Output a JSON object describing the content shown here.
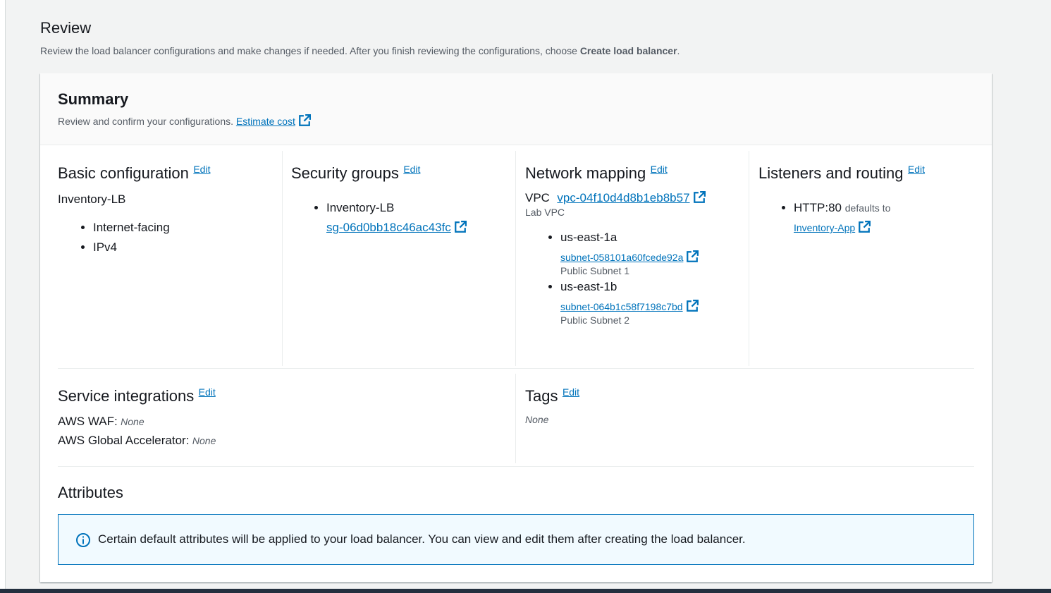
{
  "review": {
    "title": "Review",
    "description_prefix": "Review the load balancer configurations and make changes if needed. After you finish reviewing the configurations, choose ",
    "description_bold": "Create load balancer",
    "description_suffix": "."
  },
  "summary": {
    "title": "Summary",
    "description": "Review and confirm your configurations.",
    "estimate_cost_link": "Estimate cost"
  },
  "edit_label": "Edit",
  "basic_configuration": {
    "title": "Basic configuration",
    "name": "Inventory-LB",
    "items": [
      "Internet-facing",
      "IPv4"
    ]
  },
  "security_groups": {
    "title": "Security groups",
    "group_name": "Inventory-LB",
    "group_id": "sg-06d0bb18c46ac43fc"
  },
  "network_mapping": {
    "title": "Network mapping",
    "vpc_label": "VPC",
    "vpc_id": "vpc-04f10d4d8b1eb8b57",
    "vpc_name": "Lab VPC",
    "zones": [
      {
        "zone": "us-east-1a",
        "subnet_id": "subnet-058101a60fcede92a",
        "subnet_name": "Public Subnet 1"
      },
      {
        "zone": "us-east-1b",
        "subnet_id": "subnet-064b1c58f7198c7bd",
        "subnet_name": "Public Subnet 2"
      }
    ]
  },
  "listeners": {
    "title": "Listeners and routing",
    "listener": "HTTP:80",
    "defaults_to": "defaults to",
    "target_group": "Inventory-App"
  },
  "service_integrations": {
    "title": "Service integrations",
    "waf_label": "AWS WAF:",
    "waf_value": "None",
    "ga_label": "AWS Global Accelerator:",
    "ga_value": "None"
  },
  "tags": {
    "title": "Tags",
    "value": "None"
  },
  "attributes": {
    "title": "Attributes",
    "info_text": "Certain default attributes will be applied to your load balancer. You can view and edit them after creating the load balancer."
  },
  "colors": {
    "link": "#0073bb",
    "info_bg": "#f1faff",
    "info_border": "#0073bb"
  }
}
